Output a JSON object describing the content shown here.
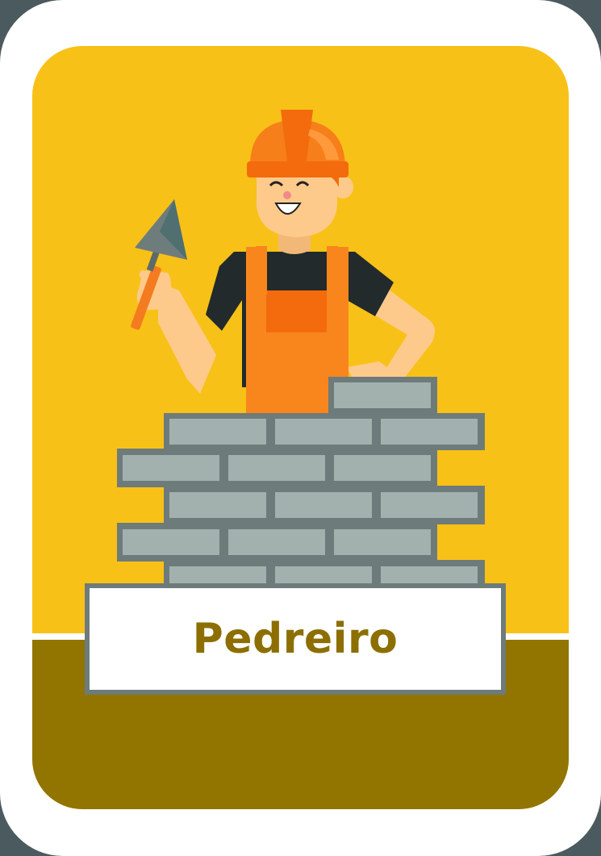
{
  "card": {
    "title": "Pedreiro"
  },
  "colors": {
    "background": "#f8c118",
    "ground": "#917500",
    "title": "#8c6f00",
    "brick": "#a2b1ad",
    "mortar": "#6d7b7b",
    "helmet": "#f77f1a",
    "overalls": "#f8861d",
    "shirt": "#222222",
    "skin": "#fdca8b"
  },
  "icons": {
    "illustration": "bricklayer-illustration"
  }
}
